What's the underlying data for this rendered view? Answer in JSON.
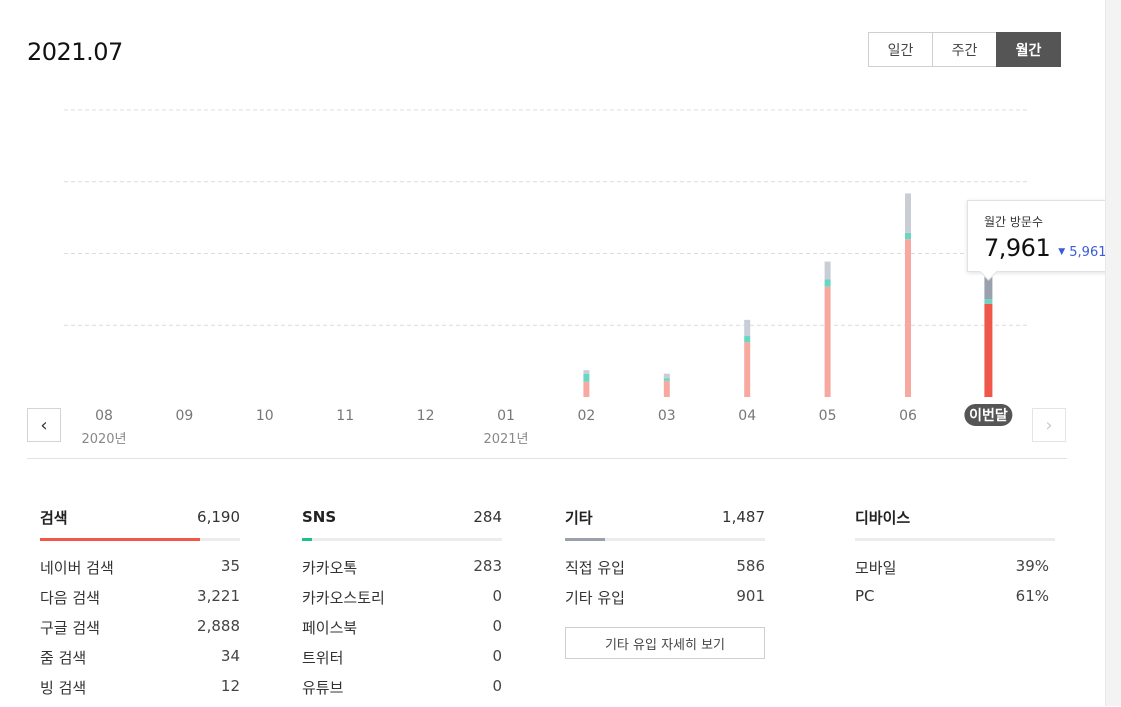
{
  "header": {
    "title": "2021.07",
    "period_tabs": [
      {
        "label": "일간",
        "active": false
      },
      {
        "label": "주간",
        "active": false
      },
      {
        "label": "월간",
        "active": true
      }
    ]
  },
  "colors": {
    "search": "#f0564a",
    "search_past": "#f7a9a0",
    "sns": "#69d6c3",
    "etc": "#c9ced6",
    "etc_current": "#9aa1ad",
    "grid": "#dcdcdc",
    "badge": "#555555",
    "sns_accent": "#1dbf8f",
    "etc_accent": "#9aa1ad",
    "change_down": "#3b5bdb"
  },
  "chart_data": {
    "type": "bar",
    "stacked": true,
    "categories": [
      "08",
      "09",
      "10",
      "11",
      "12",
      "01",
      "02",
      "03",
      "04",
      "05",
      "06",
      "이번달"
    ],
    "year_labels": [
      {
        "category": "08",
        "label": "2020년"
      },
      {
        "category": "01",
        "label": "2021년"
      }
    ],
    "series": [
      {
        "key": "search",
        "values": [
          0,
          0,
          0,
          0,
          0,
          0,
          850,
          900,
          3050,
          6150,
          8800,
          5200
        ]
      },
      {
        "key": "sns",
        "values": [
          0,
          0,
          0,
          0,
          0,
          0,
          450,
          150,
          350,
          400,
          350,
          250
        ]
      },
      {
        "key": "etc",
        "values": [
          0,
          0,
          0,
          0,
          0,
          0,
          200,
          250,
          900,
          1000,
          2200,
          1450
        ]
      }
    ],
    "ylim": [
      0,
      16000
    ],
    "grid": true,
    "gridlines": [
      4000,
      8000,
      12000,
      16000
    ],
    "highlight_category": "이번달",
    "tooltip": {
      "label": "월간 방문수",
      "value": "7,961",
      "change": "5,961",
      "change_direction": "down"
    }
  },
  "nav": {
    "prev_icon": "chevron-left-icon",
    "next_icon": "chevron-right-icon"
  },
  "stats": {
    "search": {
      "title": "검색",
      "total": "6,190",
      "bar_fill": 0.8,
      "rows": [
        {
          "label": "네이버 검색",
          "value": "35"
        },
        {
          "label": "다음 검색",
          "value": "3,221"
        },
        {
          "label": "구글 검색",
          "value": "2,888"
        },
        {
          "label": "줌 검색",
          "value": "34"
        },
        {
          "label": "빙 검색",
          "value": "12"
        }
      ]
    },
    "sns": {
      "title": "SNS",
      "total": "284",
      "bar_fill": 0.05,
      "rows": [
        {
          "label": "카카오톡",
          "value": "283"
        },
        {
          "label": "카카오스토리",
          "value": "0"
        },
        {
          "label": "페이스북",
          "value": "0"
        },
        {
          "label": "트위터",
          "value": "0"
        },
        {
          "label": "유튜브",
          "value": "0"
        }
      ]
    },
    "etc": {
      "title": "기타",
      "total": "1,487",
      "bar_fill": 0.2,
      "rows": [
        {
          "label": "직접 유입",
          "value": "586"
        },
        {
          "label": "기타 유입",
          "value": "901"
        }
      ],
      "detail_button": "기타 유입 자세히 보기"
    },
    "device": {
      "title": "디바이스",
      "bar_fill": 0,
      "rows": [
        {
          "label": "모바일",
          "value": "39%"
        },
        {
          "label": "PC",
          "value": "61%"
        }
      ]
    }
  }
}
